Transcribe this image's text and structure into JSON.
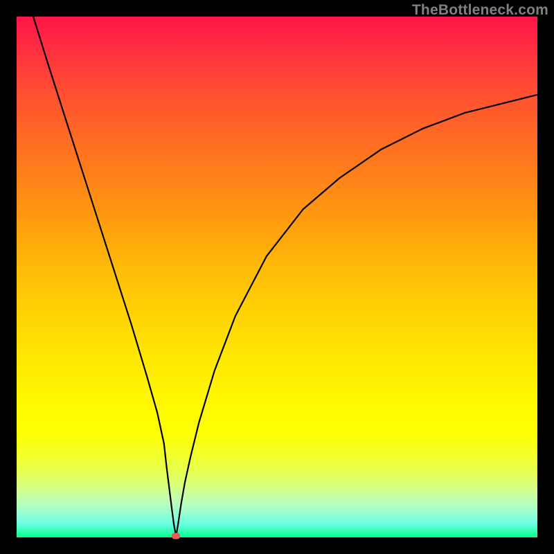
{
  "watermark": "TheBottleneck.com",
  "chart_data": {
    "type": "line",
    "title": "",
    "xlabel": "",
    "ylabel": "",
    "xlim": [
      0,
      100
    ],
    "ylim": [
      0,
      100
    ],
    "grid": false,
    "legend": false,
    "series": [
      {
        "name": "curve",
        "color": "#000000",
        "x": [
          3.2,
          6,
          10,
          14,
          18,
          22,
          25,
          27,
          28.3,
          28.8,
          29.3,
          29.8,
          30.2,
          30.6,
          31,
          31.6,
          32.3,
          33.4,
          35,
          38,
          42,
          48,
          55,
          62,
          70,
          78,
          86,
          94,
          100
        ],
        "y": [
          100,
          91,
          78.5,
          66,
          53.5,
          41,
          31,
          24,
          18,
          13.5,
          9.5,
          5.5,
          2.5,
          0.2,
          2.5,
          6.5,
          10.5,
          15.5,
          22,
          32,
          42.5,
          54,
          63,
          69,
          74.5,
          78.5,
          81.5,
          83.5,
          85
        ]
      }
    ],
    "marker": {
      "x": 30.6,
      "y": 0.2,
      "color": "#e85c56"
    }
  }
}
